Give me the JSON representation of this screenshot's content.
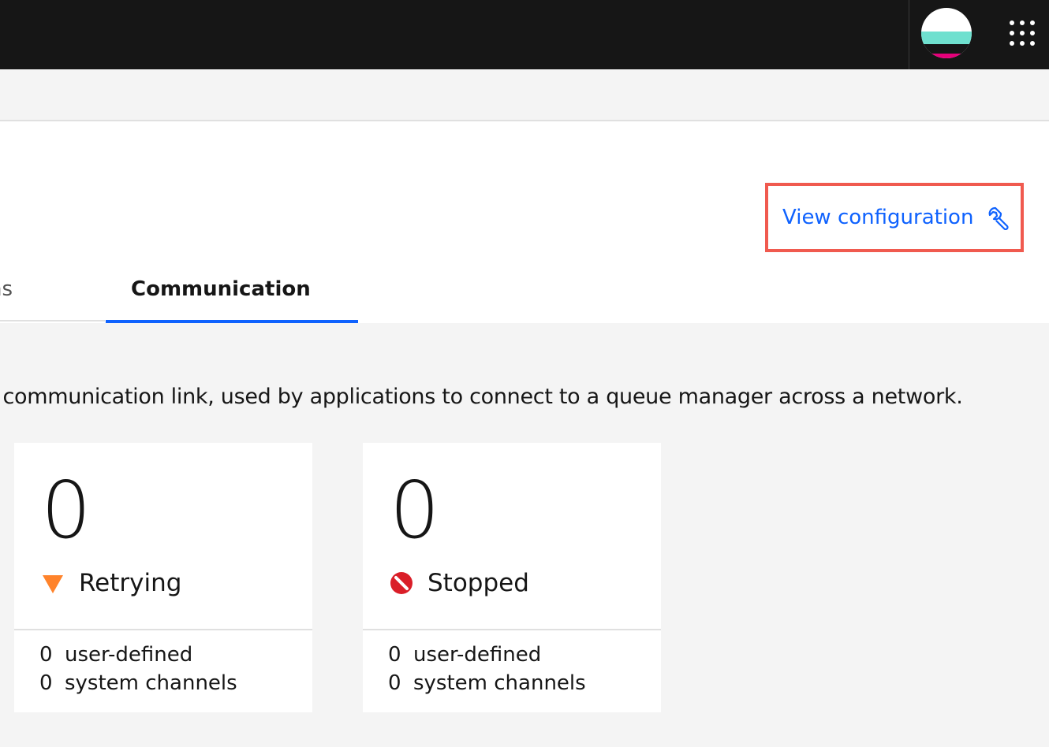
{
  "header": {
    "avatar_icon": "user-avatar-icon",
    "app_switcher_icon": "app-switcher-grid-icon"
  },
  "toolbar": {
    "view_configuration_label": "View configuration",
    "view_configuration_icon": "wrench-icon",
    "highlight_color": "#f05a4f",
    "link_color": "#0f62fe"
  },
  "tabs": [
    {
      "label": "ns",
      "active": false
    },
    {
      "label": "Communication",
      "active": true
    }
  ],
  "description": "l communication link, used by applications to connect to a queue manager across a network.",
  "cards": [
    {
      "count": "0",
      "status": "Retrying",
      "status_icon": "warning-triangle-icon",
      "status_color": "#ff832b",
      "user_defined_count": "0",
      "user_defined_label": "user-defined",
      "system_count": "0",
      "system_label": "system channels"
    },
    {
      "count": "0",
      "status": "Stopped",
      "status_icon": "stopped-circle-icon",
      "status_color": "#da1e28",
      "user_defined_count": "0",
      "user_defined_label": "user-defined",
      "system_count": "0",
      "system_label": "system channels"
    }
  ]
}
